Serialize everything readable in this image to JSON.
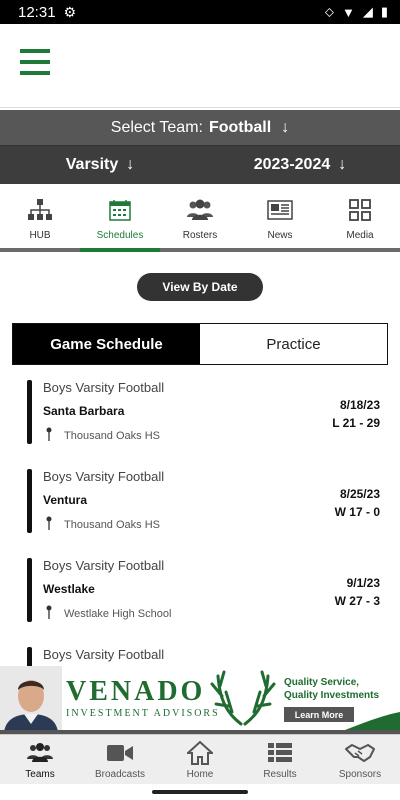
{
  "status_bar": {
    "time": "12:31"
  },
  "team_selector": {
    "label": "Select Team:",
    "value": "Football"
  },
  "level": "Varsity",
  "season": "2023-2024",
  "tabs": [
    {
      "label": "HUB",
      "icon": "hierarchy-icon"
    },
    {
      "label": "Schedules",
      "icon": "calendar-icon",
      "active": true
    },
    {
      "label": "Rosters",
      "icon": "people-icon"
    },
    {
      "label": "News",
      "icon": "newspaper-icon"
    },
    {
      "label": "Media",
      "icon": "grid-icon"
    }
  ],
  "view_by_date_label": "View By Date",
  "segment": {
    "game_schedule": "Game Schedule",
    "practice": "Practice"
  },
  "games": [
    {
      "sport": "Boys Varsity Football",
      "opponent": "Santa Barbara",
      "location": "Thousand Oaks HS",
      "date": "8/18/23",
      "result": "L 21 - 29"
    },
    {
      "sport": "Boys Varsity Football",
      "opponent": "Ventura",
      "location": "Thousand Oaks HS",
      "date": "8/25/23",
      "result": "W 17 - 0"
    },
    {
      "sport": "Boys Varsity Football",
      "opponent": "Westlake",
      "location": "Westlake High School",
      "date": "9/1/23",
      "result": "W 27 - 3"
    },
    {
      "sport": "Boys Varsity Football",
      "opponent": "",
      "location": "",
      "date": "",
      "result": ""
    }
  ],
  "ad": {
    "brand": "VENADO",
    "subtitle": "INVESTMENT ADVISORS",
    "tagline_1": "Quality Service,",
    "tagline_2": "Quality Investments",
    "cta": "Learn More"
  },
  "bottom_nav": [
    {
      "label": "Teams",
      "icon": "teams-icon",
      "active": true
    },
    {
      "label": "Broadcasts",
      "icon": "video-camera-icon"
    },
    {
      "label": "Home",
      "icon": "home-icon"
    },
    {
      "label": "Results",
      "icon": "results-list-icon"
    },
    {
      "label": "Sponsors",
      "icon": "handshake-icon"
    }
  ],
  "colors": {
    "accent": "#1f7a3a",
    "dark_band": "#3d3d3d",
    "mid_band": "#575757"
  }
}
